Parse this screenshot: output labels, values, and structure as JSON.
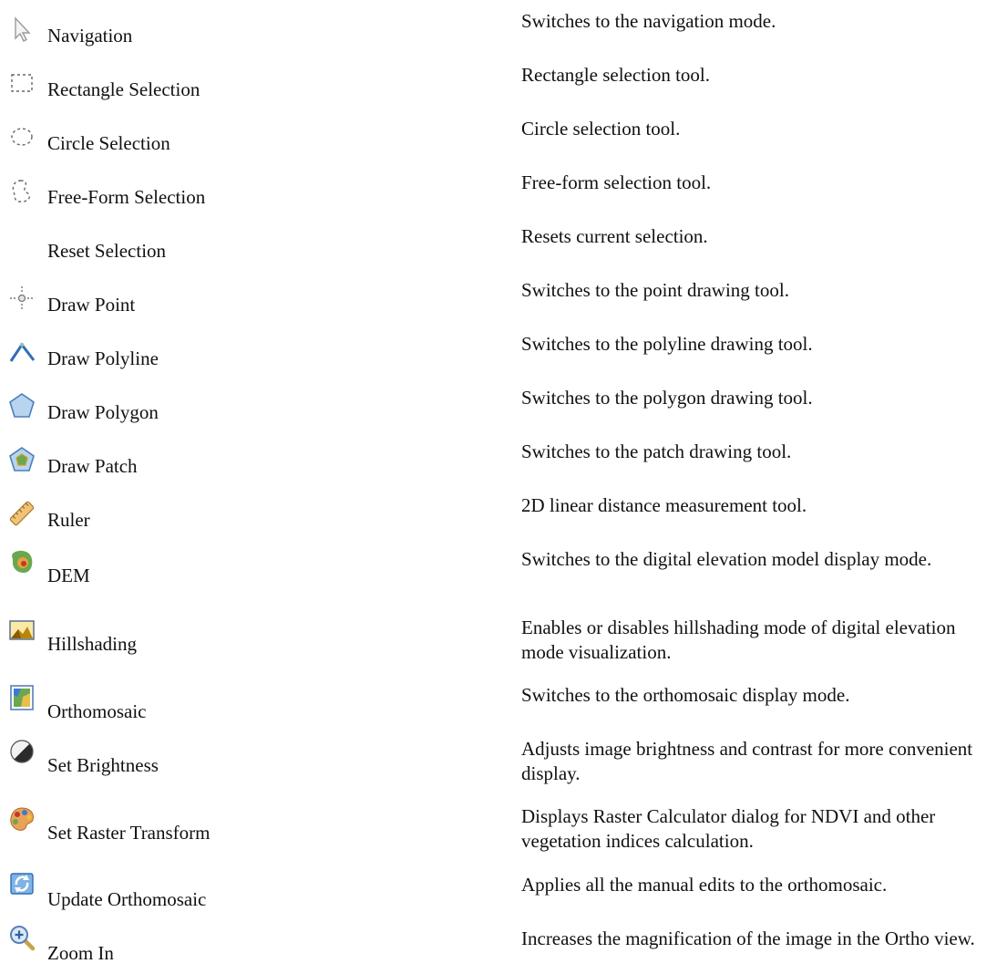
{
  "tools": [
    {
      "icon": "navigation-cursor-icon",
      "name": "Navigation",
      "description": "Switches to the navigation mode."
    },
    {
      "icon": "rectangle-selection-icon",
      "name": "Rectangle Selection",
      "description": "Rectangle selection tool."
    },
    {
      "icon": "circle-selection-icon",
      "name": "Circle Selection",
      "description": "Circle selection tool."
    },
    {
      "icon": "freeform-selection-icon",
      "name": "Free-Form Selection",
      "description": "Free-form selection tool."
    },
    {
      "icon": "",
      "name": "Reset Selection",
      "description": "Resets current selection."
    },
    {
      "icon": "draw-point-icon",
      "name": "Draw Point",
      "description": "Switches to the point drawing tool."
    },
    {
      "icon": "draw-polyline-icon",
      "name": "Draw Polyline",
      "description": "Switches to the polyline drawing tool."
    },
    {
      "icon": "draw-polygon-icon",
      "name": "Draw Polygon",
      "description": "Switches to the polygon drawing tool."
    },
    {
      "icon": "draw-patch-icon",
      "name": "Draw Patch",
      "description": "Switches to the patch drawing tool."
    },
    {
      "icon": "ruler-icon",
      "name": "Ruler",
      "description": "2D linear distance measurement tool."
    },
    {
      "icon": "dem-icon",
      "name": "DEM",
      "description": "Switches to the digital elevation model display mode."
    },
    {
      "icon": "hillshading-icon",
      "name": "Hillshading",
      "description": "Enables or disables hillshading mode of digital elevation mode visualization."
    },
    {
      "icon": "orthomosaic-icon",
      "name": "Orthomosaic",
      "description": "Switches to the orthomosaic display mode."
    },
    {
      "icon": "brightness-icon",
      "name": "Set Brightness",
      "description": "Adjusts image brightness and contrast for more convenient display."
    },
    {
      "icon": "raster-transform-icon",
      "name": "Set Raster Transform",
      "description": "Displays Raster Calculator dialog for NDVI and other vegetation indices calculation."
    },
    {
      "icon": "update-orthomosaic-icon",
      "name": "Update Orthomosaic",
      "description": "Applies all the manual edits to the orthomosaic."
    },
    {
      "icon": "zoom-in-icon",
      "name": "Zoom In",
      "description": "Increases the magnification of the image in the Ortho view."
    }
  ]
}
